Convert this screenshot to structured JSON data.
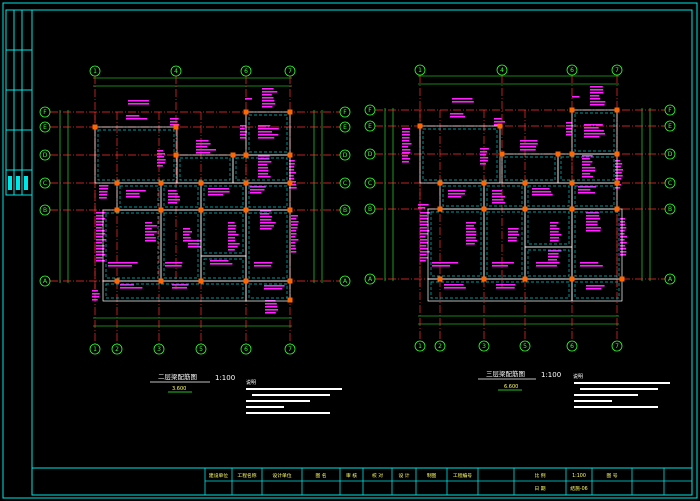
{
  "drawing": {
    "plan_left": {
      "title": "二层梁配筋图",
      "scale": "1:100",
      "elev": "3.600",
      "grid_top": [
        "1",
        "4",
        "6",
        "7"
      ],
      "grid_bottom": [
        "1",
        "2",
        "3",
        "5",
        "6",
        "7"
      ],
      "grid_rows": [
        "F",
        "E",
        "D",
        "C",
        "B",
        "A"
      ]
    },
    "plan_right": {
      "title": "三层梁配筋图",
      "scale": "1:100",
      "elev": "6.600",
      "grid_top": [
        "1",
        "4",
        "6",
        "7"
      ],
      "grid_bottom": [
        "1",
        "2",
        "3",
        "5",
        "6",
        "7"
      ],
      "grid_rows": [
        "F",
        "E",
        "D",
        "C",
        "B",
        "A"
      ]
    },
    "notes_heading": "说明",
    "title_block": {
      "row1": [
        "建设单位",
        "工程名称",
        "设计单位",
        "图 名",
        "审 核",
        "校 对",
        "设 计",
        "制图",
        "工程编号",
        "",
        "比 例",
        "1:100",
        "图 号"
      ],
      "row2": [
        "",
        "",
        "",
        "",
        "",
        "",
        "",
        "",
        "",
        "",
        "日 期",
        "结施-06",
        ""
      ]
    }
  },
  "colors": {
    "background": "#000000",
    "border": "#00e5e5",
    "grid_axis": "#ff3030",
    "grid_circle": "#33ff33",
    "beam_outline": "#ffffff",
    "beam_dashed": "#00c8c8",
    "rebar_text": "#ff22ff",
    "dimension": "#33ff33",
    "column": "#ff6600",
    "frame_text": "#ffff66"
  }
}
